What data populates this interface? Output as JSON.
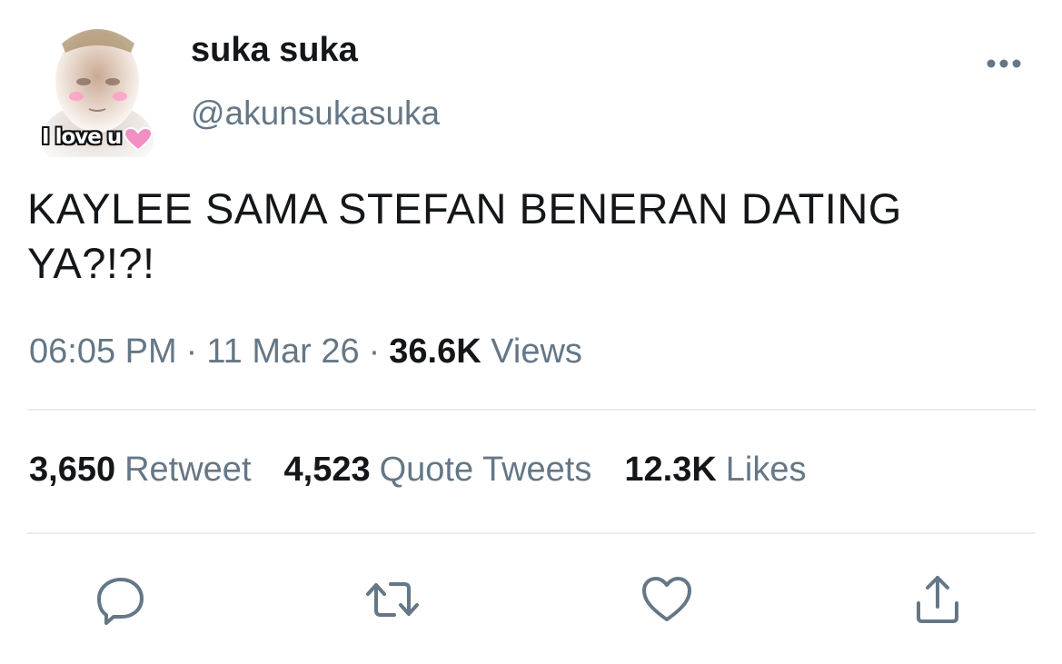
{
  "author": {
    "display_name": "suka suka",
    "handle": "@akunsukasuka",
    "avatar_caption": "I love u"
  },
  "tweet": {
    "text": "KAYLEE SAMA STEFAN BENERAN DATING YA?!?!"
  },
  "meta": {
    "time": "06:05 PM",
    "separator": "·",
    "date": "11 Mar 26",
    "views_count": "36.6K",
    "views_label": "Views"
  },
  "stats": {
    "retweets_count": "3,650",
    "retweets_label": "Retweet",
    "quotes_count": "4,523",
    "quotes_label": "Quote Tweets",
    "likes_count": "12.3K",
    "likes_label": "Likes"
  },
  "actions": {
    "icons": [
      "reply-icon",
      "retweet-icon",
      "like-icon",
      "share-icon"
    ]
  },
  "colors": {
    "primary_text": "#14171a",
    "secondary_text": "#657786",
    "divider": "#e6ecf0",
    "icon": "#657786",
    "heart_accent": "#f48fc4"
  }
}
